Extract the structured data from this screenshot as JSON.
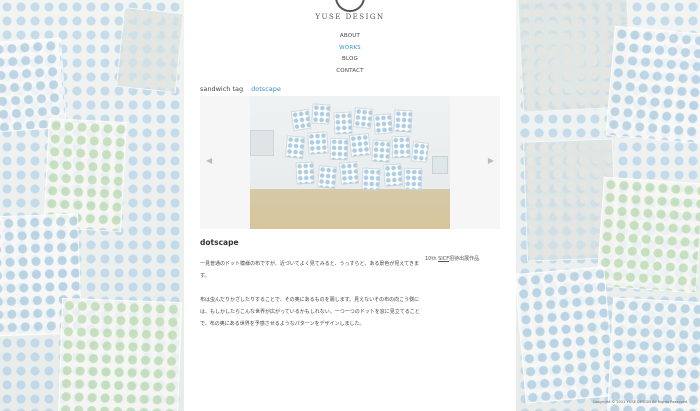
{
  "site": {
    "logo_text": "YUSE DESIGN"
  },
  "nav": {
    "items": [
      {
        "label": "ABOUT"
      },
      {
        "label": "WORKS"
      },
      {
        "label": "BLOG"
      },
      {
        "label": "CONTACT"
      }
    ],
    "active": "WORKS"
  },
  "breadcrumb": {
    "tag": "sandwich tag",
    "current": "dotscape"
  },
  "slider": {
    "prev_glyph": "◀",
    "next_glyph": "▶"
  },
  "work": {
    "title": "dotscape",
    "side_note_prefix": "10th ",
    "side_note_link": "SICF",
    "side_note_suffix": "招待出展作品",
    "paragraphs": [
      "一見普通のドット模様の布ですが、近づいてよく見てみると、うっすらと、ある景色が見えてきます。",
      "布は虫んだりかざしたりすることで、その奥にあるものを覗します。見えないその布の向こう側には、もしかしたらこんな世界が広がっているかもしれない。一つ一つのドットを窓に見立てることで、布の奥にある世界を予感させるようなパターンをデザインしました。"
    ]
  },
  "footer": {
    "copyright": "Copyright © 2011 YUSE DESIGN All Rights Reserved."
  },
  "colors": {
    "accent": "#3a8fd0",
    "text": "#444444",
    "panel": "#ffffff"
  }
}
